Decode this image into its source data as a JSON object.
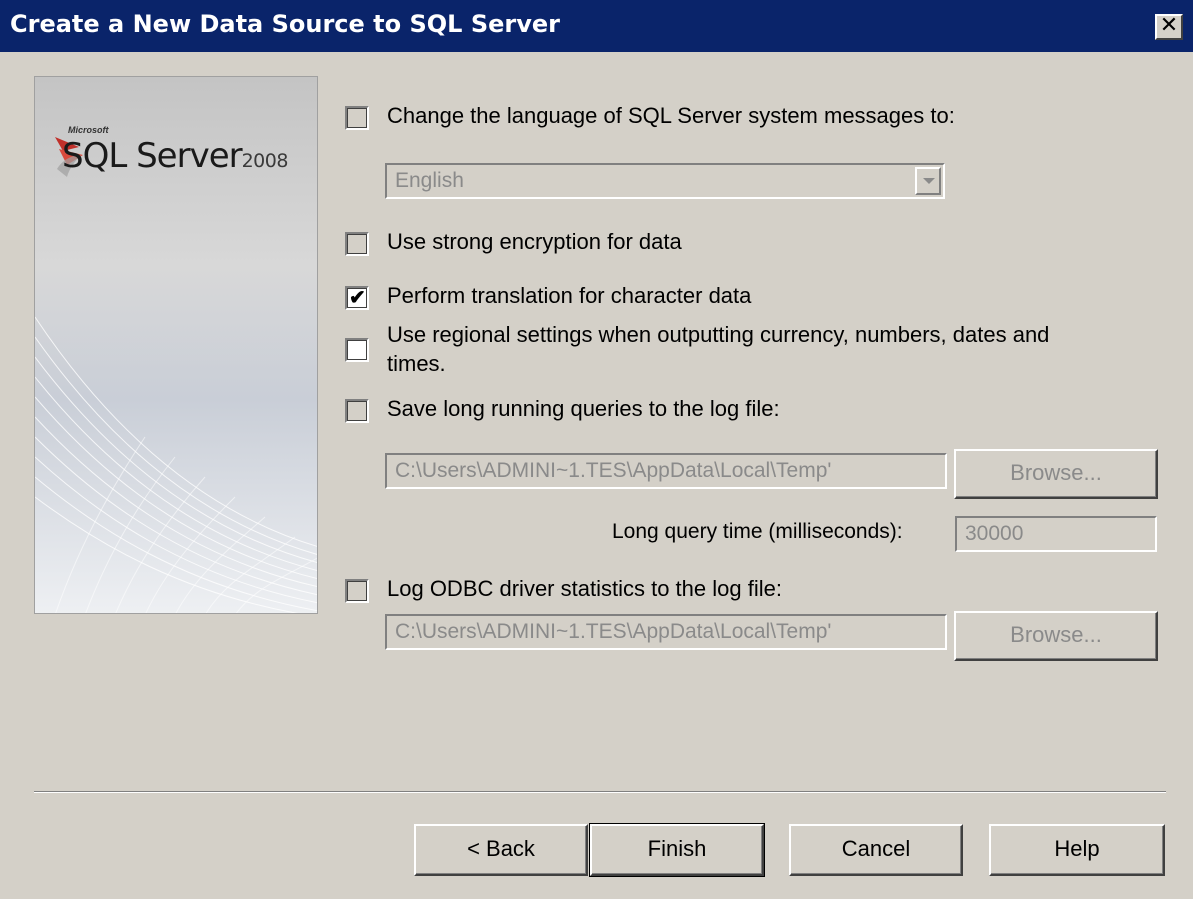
{
  "window": {
    "title": "Create a New Data Source to SQL Server",
    "close_glyph": "✕"
  },
  "banner": {
    "brand_small": "Microsoft",
    "product": "SQL Server",
    "year": "2008"
  },
  "options": {
    "change_language": {
      "label": "Change the language of SQL Server system messages to:",
      "checked": false,
      "enabled": false
    },
    "language_select": {
      "value": "English",
      "enabled": false
    },
    "strong_encryption": {
      "label": "Use strong encryption for data",
      "checked": false,
      "enabled": false
    },
    "translate_char_data": {
      "label": "Perform translation for character data",
      "checked": true,
      "enabled": true
    },
    "regional_settings": {
      "label_line1": "Use regional settings when outputting currency, numbers, dates and",
      "label_line2": "times.",
      "checked": false,
      "enabled": true
    },
    "save_long_queries": {
      "label": "Save long running queries to the log file:",
      "checked": false,
      "enabled": false
    },
    "long_query_log_path": {
      "value": "C:\\Users\\ADMINI~1.TES\\AppData\\Local\\Temp'",
      "enabled": false
    },
    "long_query_browse": {
      "label": "Browse...",
      "enabled": false
    },
    "long_query_time": {
      "label": "Long query time (milliseconds):",
      "value": "30000",
      "enabled": false
    },
    "log_odbc_stats": {
      "label": "Log ODBC driver statistics to the log file:",
      "checked": false,
      "enabled": false
    },
    "odbc_stats_log_path": {
      "value": "C:\\Users\\ADMINI~1.TES\\AppData\\Local\\Temp'",
      "enabled": false
    },
    "odbc_stats_browse": {
      "label": "Browse...",
      "enabled": false
    }
  },
  "footer": {
    "back_label": "< Back",
    "finish_label": "Finish",
    "cancel_label": "Cancel",
    "help_label": "Help"
  },
  "icons": {
    "check_glyph": "✔"
  }
}
